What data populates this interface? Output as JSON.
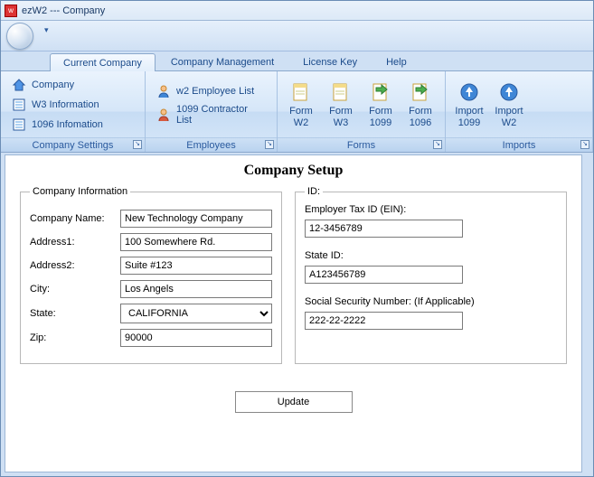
{
  "window": {
    "title": "ezW2 --- Company"
  },
  "tabs": {
    "current_company": "Current Company",
    "company_management": "Company Management",
    "license_key": "License Key",
    "help": "Help"
  },
  "ribbon": {
    "company_settings": {
      "label": "Company Settings",
      "items": {
        "company": "Company",
        "w3_info": "W3 Information",
        "i1096_info": "1096 Infomation"
      }
    },
    "employees": {
      "label": "Employees",
      "items": {
        "w2_list": "w2 Employee List",
        "c1099_list": "1099 Contractor List"
      }
    },
    "forms": {
      "label": "Forms",
      "items": {
        "form_w2": "Form\nW2",
        "form_w3": "Form\nW3",
        "form_1099": "Form\n1099",
        "form_1096": "Form\n1096"
      }
    },
    "imports": {
      "label": "Imports",
      "items": {
        "import_1099": "Import\n1099",
        "import_w2": "Import\nW2"
      }
    }
  },
  "page": {
    "title": "Company Setup",
    "group_company_info": "Company Information",
    "group_id": "ID:",
    "labels": {
      "company_name": "Company Name:",
      "address1": "Address1:",
      "address2": "Address2:",
      "city": "City:",
      "state": "State:",
      "zip": "Zip:",
      "ein": "Employer Tax ID (EIN):",
      "state_id": "State ID:",
      "ssn": "Social Security Number: (If Applicable)"
    },
    "values": {
      "company_name": "New Technology Company",
      "address1": "100 Somewhere Rd.",
      "address2": "Suite #123",
      "city": "Los Angels",
      "state": "CALIFORNIA",
      "zip": "90000",
      "ein": "12-3456789",
      "state_id": "A123456789",
      "ssn": "222-22-2222"
    },
    "update_label": "Update"
  }
}
